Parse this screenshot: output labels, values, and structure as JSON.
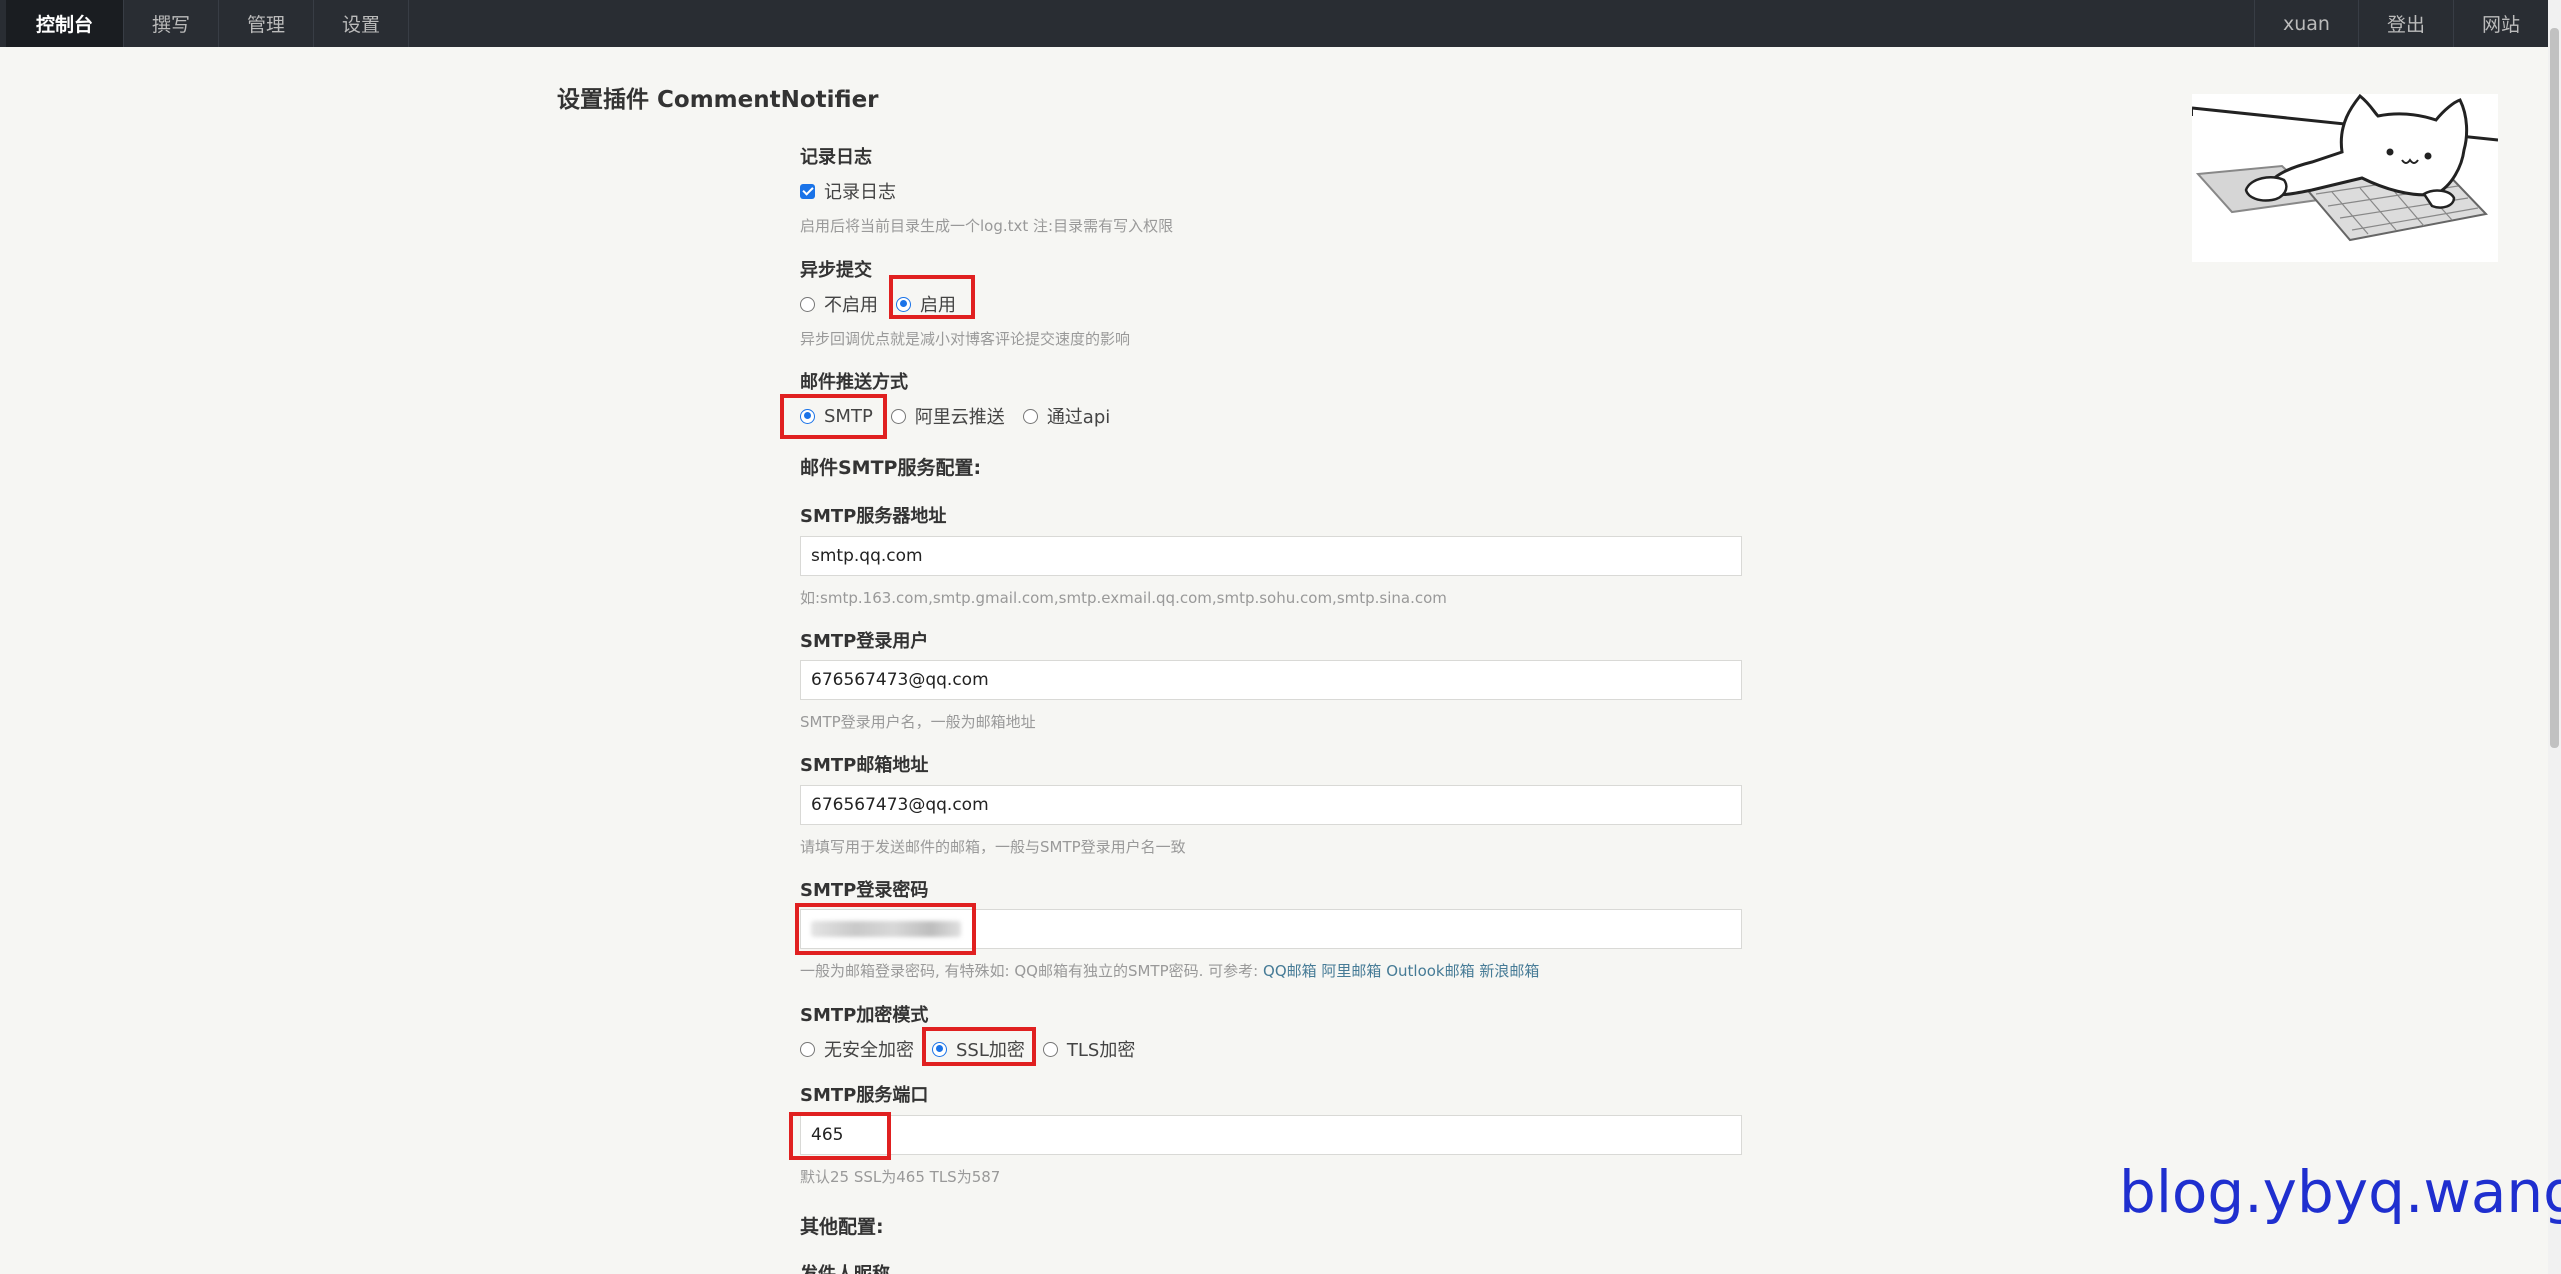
{
  "nav": {
    "left": [
      "控制台",
      "撰写",
      "管理",
      "设置"
    ],
    "right": [
      "xuan",
      "登出",
      "网站"
    ]
  },
  "page_title": "设置插件 CommentNotifier",
  "log": {
    "title": "记录日志",
    "checkbox_label": "记录日志",
    "desc": "启用后将当前目录生成一个log.txt 注:目录需有写入权限"
  },
  "async": {
    "title": "异步提交",
    "options": [
      "不启用",
      "启用"
    ],
    "selected": "启用",
    "desc": "异步回调优点就是减小对博客评论提交速度的影响"
  },
  "mail_method": {
    "title": "邮件推送方式",
    "options": [
      "SMTP",
      "阿里云推送",
      "通过api"
    ],
    "selected": "SMTP"
  },
  "smtp_section_title": "邮件SMTP服务配置:",
  "smtp_host": {
    "label": "SMTP服务器地址",
    "value": "smtp.qq.com",
    "desc": "如:smtp.163.com,smtp.gmail.com,smtp.exmail.qq.com,smtp.sohu.com,smtp.sina.com"
  },
  "smtp_user": {
    "label": "SMTP登录用户",
    "value": "676567473@qq.com",
    "desc": "SMTP登录用户名，一般为邮箱地址"
  },
  "smtp_mail": {
    "label": "SMTP邮箱地址",
    "value": "676567473@qq.com",
    "desc": "请填写用于发送邮件的邮箱，一般与SMTP登录用户名一致"
  },
  "smtp_pass": {
    "label": "SMTP登录密码",
    "desc": "一般为邮箱登录密码, 有特殊如: QQ邮箱有独立的SMTP密码. 可参考: ",
    "links": [
      "QQ邮箱",
      "阿里邮箱",
      "Outlook邮箱",
      "新浪邮箱"
    ]
  },
  "smtp_secure": {
    "label": "SMTP加密模式",
    "options": [
      "无安全加密",
      "SSL加密",
      "TLS加密"
    ],
    "selected": "SSL加密"
  },
  "smtp_port": {
    "label": "SMTP服务端口",
    "value": "465",
    "desc": "默认25 SSL为465 TLS为587"
  },
  "other_section_title": "其他配置:",
  "next_field_label": "发件人昵称",
  "watermark": "blog.ybyq.wang",
  "colors": {
    "nav_bg": "#292d33",
    "accent": "#1a73e8",
    "highlight": "#e02020",
    "watermark": "#1f2fcf"
  }
}
